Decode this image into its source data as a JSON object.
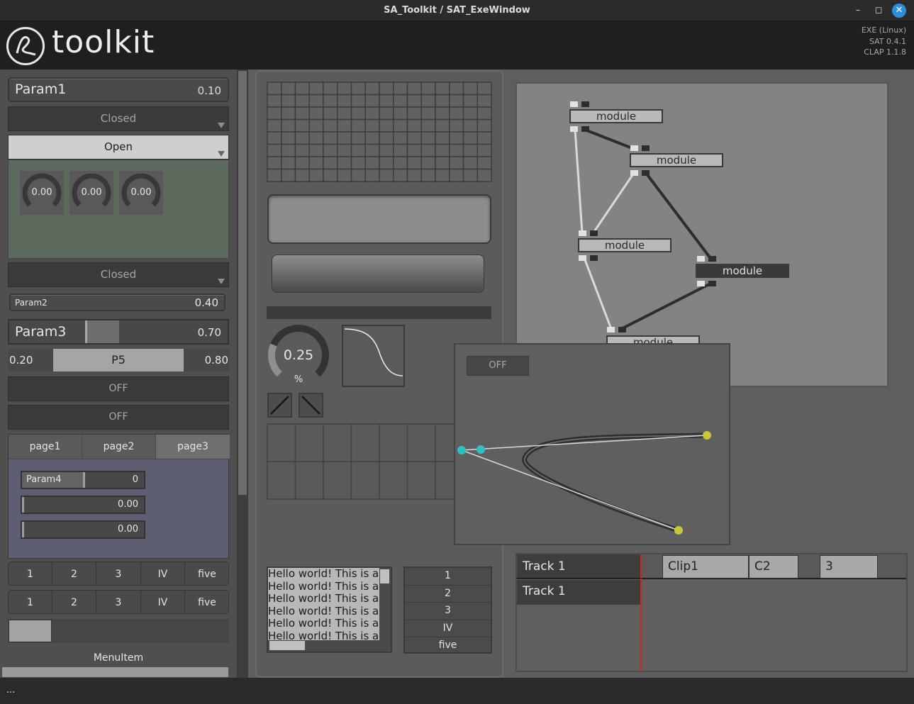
{
  "window": {
    "title": "SA_Toolkit / SAT_ExeWindow"
  },
  "header": {
    "logo_text": "toolkit",
    "version_lines": [
      "EXE (Linux)",
      "SAT 0.4.1",
      "CLAP 1.1.8"
    ]
  },
  "left": {
    "param1": {
      "label": "Param1",
      "value": "0.10"
    },
    "dropdown1": {
      "label": "Closed"
    },
    "dropdown2": {
      "label": "Open"
    },
    "knobs": [
      {
        "value": "0.00"
      },
      {
        "value": "0.00"
      },
      {
        "value": "0.00"
      }
    ],
    "dropdown3": {
      "label": "Closed"
    },
    "param2": {
      "label": "Param2",
      "value": "0.40"
    },
    "param3": {
      "label": "Param3",
      "value": "0.70",
      "fill": 0.3
    },
    "range": {
      "min": "0.20",
      "label": "P5",
      "max": "0.80"
    },
    "toggle1": "OFF",
    "toggle2": "OFF",
    "tabs": [
      "page1",
      "page2",
      "page3"
    ],
    "active_tab": "page3",
    "page_sliders": [
      {
        "label": "Param4",
        "value": "0"
      },
      {
        "label": "",
        "value": "0.00"
      },
      {
        "label": "",
        "value": "0.00"
      }
    ],
    "segments1": [
      "1",
      "2",
      "3",
      "IV",
      "five"
    ],
    "segments2": [
      "1",
      "2",
      "3",
      "IV",
      "five"
    ],
    "menu_item": "MenuItem"
  },
  "middle": {
    "grid": {
      "cols": 16,
      "rows": 8
    },
    "dial": {
      "value": "0.25",
      "unit": "%",
      "fraction": 0.25
    },
    "text_lines": [
      "Hello world! This is a",
      "Hello world! This is a",
      "Hello world! This is a",
      "Hello world! This is a",
      "Hello world! This is a",
      "Hello world! This is a"
    ],
    "list": [
      "1",
      "2",
      "3",
      "IV",
      "five"
    ]
  },
  "graph": {
    "modules": [
      "module",
      "module",
      "module",
      "module",
      "module"
    ]
  },
  "curve_editor": {
    "toggle": "OFF"
  },
  "timeline": {
    "tracks": [
      "Track 1",
      "Track 1"
    ],
    "clips": [
      "Clip1",
      "C2",
      "3"
    ]
  },
  "status": {
    "text": "..."
  },
  "colors": {
    "accent_cyan": "#2fc0c4",
    "accent_yellow": "#c9c83a",
    "playhead": "#d12020"
  }
}
